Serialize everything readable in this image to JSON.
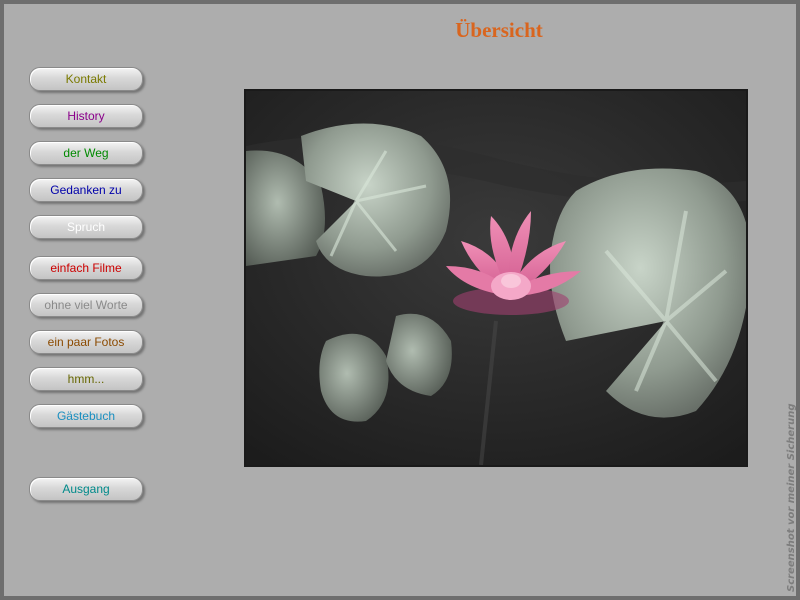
{
  "page": {
    "title": "Übersicht"
  },
  "nav": [
    {
      "label": "Kontakt",
      "color": "#7a7a00"
    },
    {
      "label": "History",
      "color": "#8b008b"
    },
    {
      "label": "der Weg",
      "color": "#008a00"
    },
    {
      "label": "Gedanken zu",
      "color": "#0000aa"
    },
    {
      "label": "Spruch",
      "color": "#ffffff"
    },
    {
      "label": "einfach Filme",
      "color": "#cc0000"
    },
    {
      "label": "ohne viel Worte",
      "color": "#8a8a8a"
    },
    {
      "label": "ein paar Fotos",
      "color": "#8b4a00"
    },
    {
      "label": "hmm...",
      "color": "#666600"
    },
    {
      "label": "Gästebuch",
      "color": "#1a8fc0"
    }
  ],
  "exit": {
    "label": "Ausgang",
    "color": "#008a8a"
  },
  "photo": {
    "subject": "pink-water-lily-photo"
  },
  "side_note": "Screenshot vor meiner Sicherung"
}
